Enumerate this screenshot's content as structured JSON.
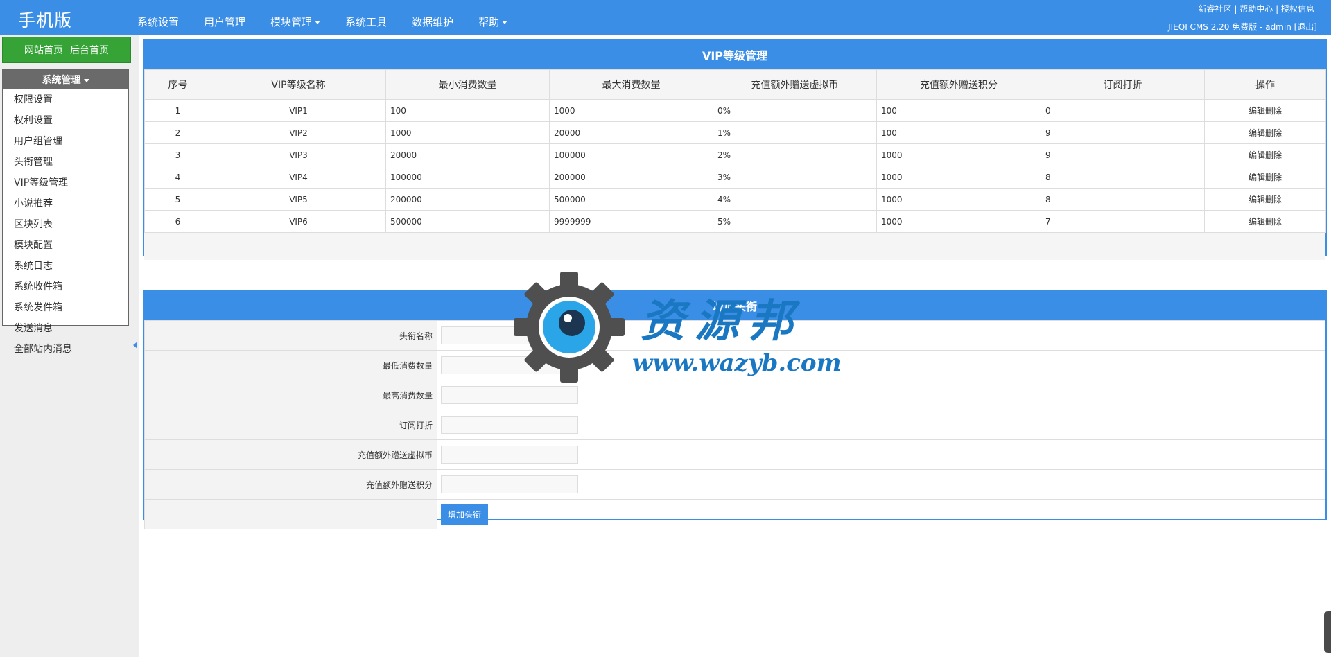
{
  "header": {
    "logo": "手机版",
    "nav": [
      {
        "label": "系统设置",
        "has_dropdown": false
      },
      {
        "label": "用户管理",
        "has_dropdown": false
      },
      {
        "label": "模块管理",
        "has_dropdown": true
      },
      {
        "label": "系统工具",
        "has_dropdown": false
      },
      {
        "label": "数据维护",
        "has_dropdown": false
      },
      {
        "label": "帮助",
        "has_dropdown": true
      }
    ],
    "links": [
      "新睿社区",
      "帮助中心",
      "授权信息"
    ],
    "link_separator": "|",
    "version": "JIEQI CMS 2.20 免费版 - admin [退出]"
  },
  "sidebar": {
    "site_home": "网站首页",
    "admin_home": "后台首页",
    "menu_title": "系统管理",
    "items": [
      "权限设置",
      "权利设置",
      "用户组管理",
      "头衔管理",
      "VIP等级管理",
      "小说推荐",
      "区块列表",
      "模块配置",
      "系统日志",
      "系统收件箱",
      "系统发件箱",
      "发送消息",
      "全部站内消息"
    ]
  },
  "vip_panel": {
    "title": "VIP等级管理",
    "columns": [
      "序号",
      "VIP等级名称",
      "最小消费数量",
      "最大消费数量",
      "充值额外赠送虚拟币",
      "充值额外赠送积分",
      "订阅打折",
      "操作"
    ],
    "rows": [
      {
        "id": "1",
        "name": "VIP1",
        "min": "100",
        "max": "1000",
        "bonus_coin": "0%",
        "bonus_points": "100",
        "discount": "0",
        "edit": "编辑",
        "delete": "删除"
      },
      {
        "id": "2",
        "name": "VIP2",
        "min": "1000",
        "max": "20000",
        "bonus_coin": "1%",
        "bonus_points": "100",
        "discount": "9",
        "edit": "编辑",
        "delete": "删除"
      },
      {
        "id": "3",
        "name": "VIP3",
        "min": "20000",
        "max": "100000",
        "bonus_coin": "2%",
        "bonus_points": "1000",
        "discount": "9",
        "edit": "编辑",
        "delete": "删除"
      },
      {
        "id": "4",
        "name": "VIP4",
        "min": "100000",
        "max": "200000",
        "bonus_coin": "3%",
        "bonus_points": "1000",
        "discount": "8",
        "edit": "编辑",
        "delete": "删除"
      },
      {
        "id": "5",
        "name": "VIP5",
        "min": "200000",
        "max": "500000",
        "bonus_coin": "4%",
        "bonus_points": "1000",
        "discount": "8",
        "edit": "编辑",
        "delete": "删除"
      },
      {
        "id": "6",
        "name": "VIP6",
        "min": "500000",
        "max": "9999999",
        "bonus_coin": "5%",
        "bonus_points": "1000",
        "discount": "7",
        "edit": "编辑",
        "delete": "删除"
      }
    ]
  },
  "add_panel": {
    "title": "增加头衔",
    "fields": [
      {
        "label": "头衔名称",
        "value": ""
      },
      {
        "label": "最低消费数量",
        "value": ""
      },
      {
        "label": "最高消费数量",
        "value": ""
      },
      {
        "label": "订阅打折",
        "value": ""
      },
      {
        "label": "充值额外赠送虚拟币",
        "value": ""
      },
      {
        "label": "充值额外赠送积分",
        "value": ""
      }
    ],
    "submit_label": "增加头衔"
  },
  "watermark": {
    "title": "资源邦",
    "url": "www.wazyb.com",
    "icon": "gear-eye-logo-icon"
  },
  "colors": {
    "primary": "#3a8ee6",
    "green": "#35a336",
    "menu_head": "#6a6a6a",
    "watermark": "#1a78c2"
  }
}
